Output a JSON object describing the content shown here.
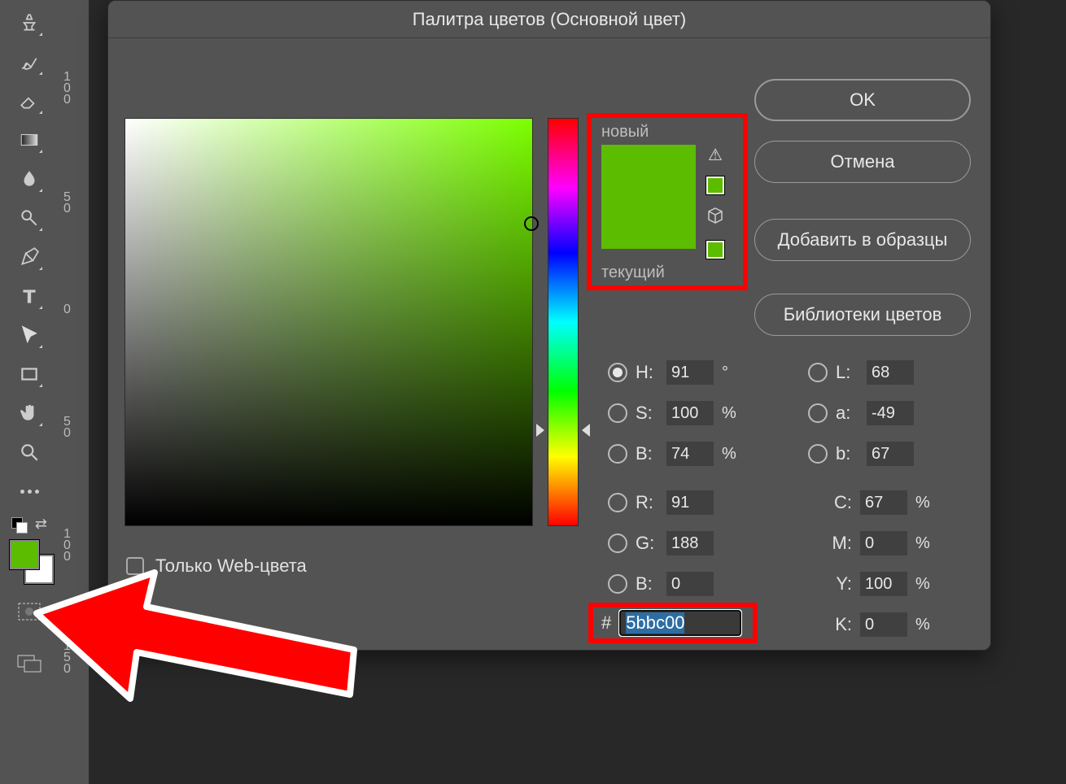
{
  "dialog": {
    "title": "Палитра цветов (Основной цвет)",
    "buttons": {
      "ok": "OK",
      "cancel": "Отмена",
      "add_swatch": "Добавить в образцы",
      "libraries": "Библиотеки цветов"
    },
    "preview": {
      "new_label": "новый",
      "current_label": "текущий",
      "new_color": "#5bbc00",
      "current_color": "#5bbc00"
    },
    "web_only_label": "Только Web-цвета",
    "fields": {
      "H": {
        "label": "H:",
        "value": "91",
        "unit": "°"
      },
      "S": {
        "label": "S:",
        "value": "100",
        "unit": "%"
      },
      "Bv": {
        "label": "B:",
        "value": "74",
        "unit": "%"
      },
      "R": {
        "label": "R:",
        "value": "91"
      },
      "G": {
        "label": "G:",
        "value": "188"
      },
      "B": {
        "label": "B:",
        "value": "0"
      },
      "L": {
        "label": "L:",
        "value": "68"
      },
      "a": {
        "label": "a:",
        "value": "-49"
      },
      "bL": {
        "label": "b:",
        "value": "67"
      },
      "C": {
        "label": "C:",
        "value": "67",
        "unit": "%"
      },
      "M": {
        "label": "M:",
        "value": "0",
        "unit": "%"
      },
      "Y": {
        "label": "Y:",
        "value": "100",
        "unit": "%"
      },
      "K": {
        "label": "K:",
        "value": "0",
        "unit": "%"
      }
    },
    "hex": {
      "hash": "#",
      "value": "5bbc00"
    }
  },
  "toolbar_fg_color": "#5bbc00",
  "ruler_labels": [
    "100",
    "50",
    "0",
    "50",
    "100",
    "150"
  ]
}
